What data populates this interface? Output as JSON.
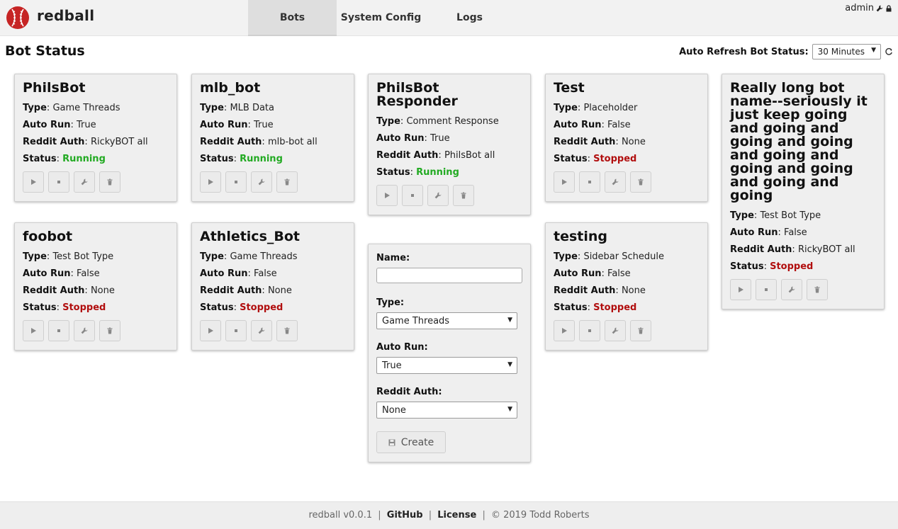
{
  "app": {
    "name": "redball"
  },
  "nav": {
    "tabs": [
      {
        "label": "Bots",
        "active": true
      },
      {
        "label": "System Config",
        "active": false
      },
      {
        "label": "Logs",
        "active": false
      }
    ],
    "user": "admin"
  },
  "header": {
    "title": "Bot Status",
    "refresh_label": "Auto Refresh Bot Status:",
    "refresh_value": "30 Minutes"
  },
  "labels": {
    "type": "Type",
    "auto_run": "Auto Run",
    "reddit_auth": "Reddit Auth",
    "status": "Status"
  },
  "bots": [
    {
      "name": "PhilsBot",
      "type": "Game Threads",
      "auto_run": "True",
      "reddit_auth": "RickyBOT all",
      "status": "Running"
    },
    {
      "name": "mlb_bot",
      "type": "MLB Data",
      "auto_run": "True",
      "reddit_auth": "mlb-bot all",
      "status": "Running"
    },
    {
      "name": "PhilsBot Responder",
      "type": "Comment Response",
      "auto_run": "True",
      "reddit_auth": "PhilsBot all",
      "status": "Running"
    },
    {
      "name": "Test",
      "type": "Placeholder",
      "auto_run": "False",
      "reddit_auth": "None",
      "status": "Stopped"
    },
    {
      "name": "Really long bot name--seriously it just keep going and going and going and going and going and going and going and going and going",
      "type": "Test Bot Type",
      "auto_run": "False",
      "reddit_auth": "RickyBOT all",
      "status": "Stopped"
    },
    {
      "name": "foobot",
      "type": "Test Bot Type",
      "auto_run": "False",
      "reddit_auth": "None",
      "status": "Stopped"
    },
    {
      "name": "Athletics_Bot",
      "type": "Game Threads",
      "auto_run": "False",
      "reddit_auth": "None",
      "status": "Stopped"
    },
    {
      "name": "testing",
      "type": "Sidebar Schedule",
      "auto_run": "False",
      "reddit_auth": "None",
      "status": "Stopped"
    }
  ],
  "create_form": {
    "name_label": "Name:",
    "name_value": "",
    "type_label": "Type:",
    "type_value": "Game Threads",
    "auto_run_label": "Auto Run:",
    "auto_run_value": "True",
    "reddit_auth_label": "Reddit Auth:",
    "reddit_auth_value": "None",
    "create_label": "Create"
  },
  "footer": {
    "version": "redball v0.0.1",
    "github": "GitHub",
    "license": "License",
    "copyright": "© 2019 Todd Roberts"
  },
  "colors": {
    "running": "#22aa22",
    "stopped": "#b10e0e",
    "logo": "#cc2222"
  },
  "icons": [
    "baseball-logo-icon",
    "wrench-icon",
    "lock-icon",
    "refresh-icon",
    "play-icon",
    "stop-icon",
    "wrench-icon",
    "trash-icon",
    "save-icon"
  ]
}
